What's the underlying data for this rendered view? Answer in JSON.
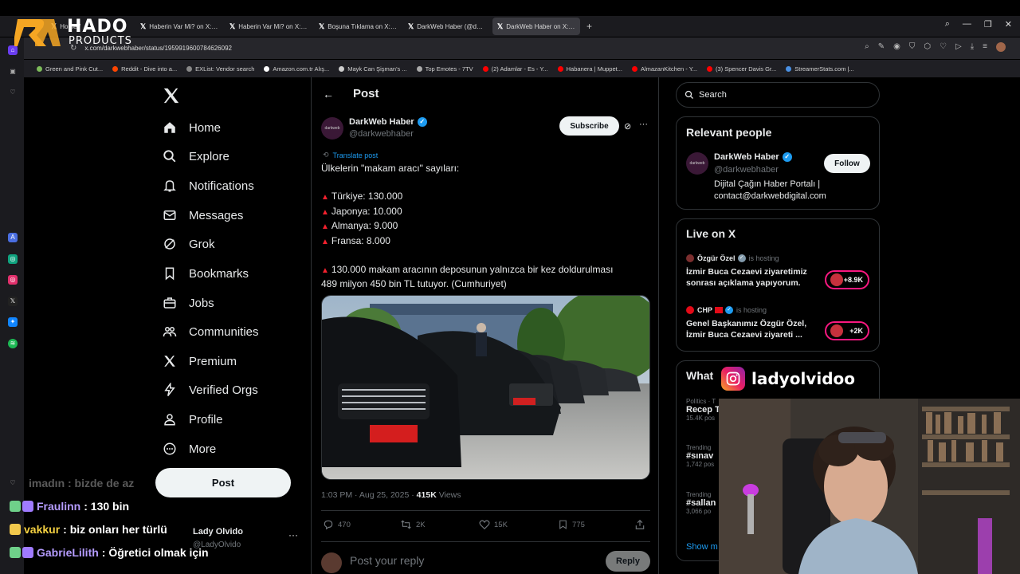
{
  "browser": {
    "tabs": [
      {
        "label": "Home /",
        "active": false
      },
      {
        "label": "Haberin Var Mi? on X: \"Ba",
        "active": false
      },
      {
        "label": "Haberin Var Mi? on X: \"Cu",
        "active": false
      },
      {
        "label": "Boşuna Tıklama on X: \"İst",
        "active": false
      },
      {
        "label": "DarkWeb Haber (@darkw",
        "active": false
      },
      {
        "label": "DarkWeb Haber on X: \"Ül",
        "active": true
      }
    ],
    "url": "x.com/darkwebhaber/status/1959919600784626092",
    "bookmarks": [
      {
        "label": "Green and Pink Cut...",
        "color": "#7dbb5a"
      },
      {
        "label": "Reddit - Dive into a...",
        "color": "#ff4500"
      },
      {
        "label": "EXList: Vendor search",
        "color": "#888888"
      },
      {
        "label": "Amazon.com.tr Alış...",
        "color": "#ffffff"
      },
      {
        "label": "Mayk Can Şişman's ...",
        "color": "#cccccc"
      },
      {
        "label": "Top Emotes - 7TV",
        "color": "#aaaaaa"
      },
      {
        "label": "(2) Adamlar - Es - Y...",
        "color": "#ff0000"
      },
      {
        "label": "Habanera | Muppet...",
        "color": "#ff0000"
      },
      {
        "label": "AlmazanKitchen - Y...",
        "color": "#ff0000"
      },
      {
        "label": "(3) Spencer Davis Gr...",
        "color": "#ff0000"
      },
      {
        "label": "StreamerStats.com |...",
        "color": "#4a90e2"
      }
    ]
  },
  "overlay": {
    "brand_main": "HADO",
    "brand_sub": "PRODUCTS",
    "instagram_handle": "ladyolvidoo"
  },
  "nav": {
    "items": [
      {
        "label": "Home",
        "icon": "home-icon"
      },
      {
        "label": "Explore",
        "icon": "search-icon"
      },
      {
        "label": "Notifications",
        "icon": "bell-icon"
      },
      {
        "label": "Messages",
        "icon": "envelope-icon"
      },
      {
        "label": "Grok",
        "icon": "grok-icon"
      },
      {
        "label": "Bookmarks",
        "icon": "bookmark-icon"
      },
      {
        "label": "Jobs",
        "icon": "briefcase-icon"
      },
      {
        "label": "Communities",
        "icon": "people-icon"
      },
      {
        "label": "Premium",
        "icon": "x-icon"
      },
      {
        "label": "Verified Orgs",
        "icon": "lightning-icon"
      },
      {
        "label": "Profile",
        "icon": "person-icon"
      },
      {
        "label": "More",
        "icon": "more-circle-icon"
      }
    ],
    "post_button": "Post",
    "account_name": "Lady Olvido",
    "account_handle": "@LadyOlvido"
  },
  "post": {
    "header_title": "Post",
    "author_name": "DarkWeb Haber",
    "author_handle": "@darkwebhaber",
    "avatar_text": "darkweb",
    "subscribe_label": "Subscribe",
    "translate_label": "Translate post",
    "text_lines": [
      {
        "text": "Ülkelerin \"makam aracı\" sayıları:",
        "bullet": false
      },
      {
        "text": "",
        "bullet": false
      },
      {
        "text": "Türkiye: 130.000",
        "bullet": true
      },
      {
        "text": "Japonya: 10.000",
        "bullet": true
      },
      {
        "text": "Almanya: 9.000",
        "bullet": true
      },
      {
        "text": "Fransa: 8.000",
        "bullet": true
      },
      {
        "text": "",
        "bullet": false
      },
      {
        "text": "130.000 makam aracının deposunun yalnızca bir kez doldurulması",
        "bullet": true
      },
      {
        "text": "489 milyon 450 bin TL tutuyor. (Cumhuriyet)",
        "bullet": false
      }
    ],
    "timestamp": "1:03 PM · Aug 25, 2025 · ",
    "views_count": "415K",
    "views_label": " Views",
    "replies": "470",
    "reposts": "2K",
    "likes": "15K",
    "bookmarks": "775",
    "reply_placeholder": "Post your reply",
    "reply_button": "Reply"
  },
  "sidebar": {
    "search_placeholder": "Search",
    "relevant_title": "Relevant people",
    "relevant": {
      "name": "DarkWeb Haber",
      "handle": "@darkwebhaber",
      "bio": "Dijital Çağın Haber Portalı | contact@darkwebdigital.com",
      "follow_label": "Follow"
    },
    "live_title": "Live on X",
    "live_items": [
      {
        "host": "Özgür Özel",
        "status": "is hosting",
        "title": "İzmir Buca Cezaevi ziyaretimiz sonrası açıklama yapıyorum.",
        "count": "+8.9K",
        "dot_color": "#7b2e2e"
      },
      {
        "host": "CHP",
        "status": "is hosting",
        "title": "Genel Başkanımız Özgür Özel, İzmir Buca Cezaevi ziyareti ...",
        "count": "+2K",
        "dot_color": "#e30a17"
      }
    ],
    "trends_title": "What",
    "trends": [
      {
        "context": "Politics · T",
        "name": "Recep T",
        "posts": "15.4K pos"
      },
      {
        "context": "Trending",
        "name": "#sınav",
        "posts": "1,742 pos"
      },
      {
        "context": "Trending",
        "name": "#sallan",
        "posts": "3,066 po"
      }
    ],
    "show_more": "Show m"
  },
  "chat": [
    {
      "user": "",
      "message": "imadın : bizde de az",
      "color": "#c8c8c8",
      "faded": true
    },
    {
      "user": "Fraulinn",
      "message": ": 130 bin",
      "color": "#b59cff",
      "faded": false
    },
    {
      "user": "vakkur",
      "message": ": biz onları her türlü",
      "color": "#f5d142",
      "faded": false
    },
    {
      "user": "GabrieLilith",
      "message": ": Öğretici olmak için",
      "color": "#b59cff",
      "faded": false
    }
  ]
}
